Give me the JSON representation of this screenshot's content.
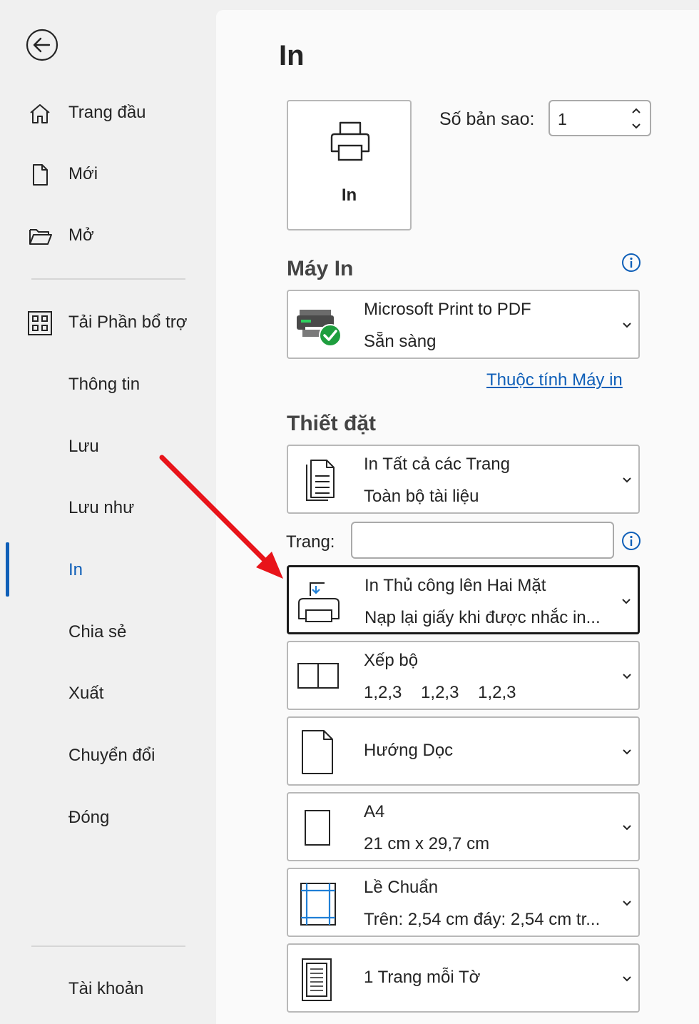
{
  "sidebar": {
    "items": [
      {
        "label": "Trang đầu"
      },
      {
        "label": "Mới"
      },
      {
        "label": "Mở"
      },
      {
        "label": "Tải Phần bổ trợ"
      },
      {
        "label": "Thông tin"
      },
      {
        "label": "Lưu"
      },
      {
        "label": "Lưu như"
      },
      {
        "label": "In"
      },
      {
        "label": "Chia sẻ"
      },
      {
        "label": "Xuất"
      },
      {
        "label": "Chuyển đổi"
      },
      {
        "label": "Đóng"
      },
      {
        "label": "Tài khoản"
      }
    ],
    "active": "In"
  },
  "main": {
    "title": "In",
    "print_button": {
      "label": "In"
    },
    "copies": {
      "label": "Số bản sao:",
      "value": "1"
    },
    "printer": {
      "section_title": "Máy In",
      "name": "Microsoft Print to PDF",
      "status": "Sẵn sàng",
      "properties_link": "Thuộc tính Máy in"
    },
    "settings": {
      "section_title": "Thiết đặt",
      "pages_label": "Trang:",
      "pages_value": "",
      "options": [
        {
          "l1": "In Tất cả các Trang",
          "l2": "Toàn bộ tài liệu"
        },
        {
          "l1": "In Thủ công lên Hai Mặt",
          "l2": "Nạp lại giấy khi được nhắc in..."
        },
        {
          "l1": "Xếp bộ",
          "l2": "1,2,3    1,2,3    1,2,3"
        },
        {
          "l1": "Hướng Dọc"
        },
        {
          "l1": "A4",
          "l2": "21 cm x 29,7 cm"
        },
        {
          "l1": "Lề Chuẩn",
          "l2": "Trên: 2,54 cm đáy: 2,54 cm tr..."
        },
        {
          "l1": "1 Trang mỗi Tờ"
        }
      ]
    }
  },
  "colors": {
    "accent": "#0f5fb8",
    "annotation_arrow": "#e8141a",
    "ready_check": "#1e9e3e"
  }
}
